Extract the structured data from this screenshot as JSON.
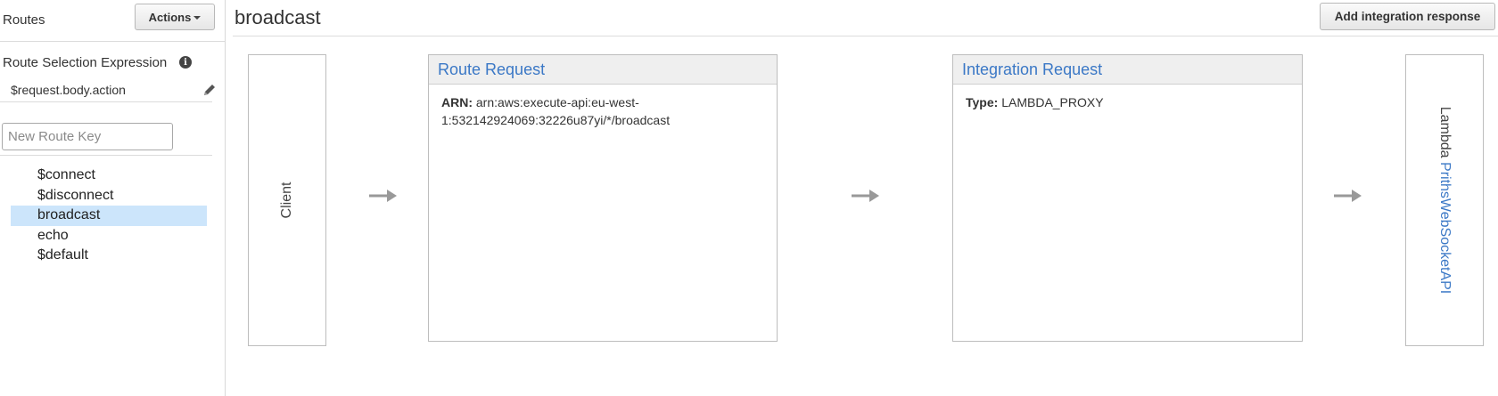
{
  "sidebar": {
    "title": "Routes",
    "actions_label": "Actions",
    "route_selection_label": "Route Selection Expression",
    "route_selection_value": "$request.body.action",
    "new_route_placeholder": "New Route Key",
    "routes": [
      {
        "label": "$connect",
        "selected": false
      },
      {
        "label": "$disconnect",
        "selected": false
      },
      {
        "label": "broadcast",
        "selected": true
      },
      {
        "label": "echo",
        "selected": false
      },
      {
        "label": "$default",
        "selected": false
      }
    ]
  },
  "main": {
    "title": "broadcast",
    "add_integration_response_label": "Add integration response",
    "client_label": "Client",
    "route_request": {
      "heading": "Route Request",
      "arn_label": "ARN:",
      "arn_line1": "arn:aws:execute-api:eu-west-",
      "arn_line2": "1:532142924069:32226u87yi/*/broadcast"
    },
    "integration_request": {
      "heading": "Integration Request",
      "type_label": "Type:",
      "type_value": "LAMBDA_PROXY"
    },
    "lambda": {
      "prefix": "Lambda",
      "function_name": "PrithsWebSocketAPI"
    }
  },
  "colors": {
    "link": "#3b78c6",
    "selected_row": "#cce5fb",
    "panel_header": "#efefef"
  },
  "icons": {
    "info": "info-icon",
    "edit": "pencil-icon",
    "flow_arrow": "arrow-right-icon",
    "dropdown": "caret-down-icon"
  }
}
